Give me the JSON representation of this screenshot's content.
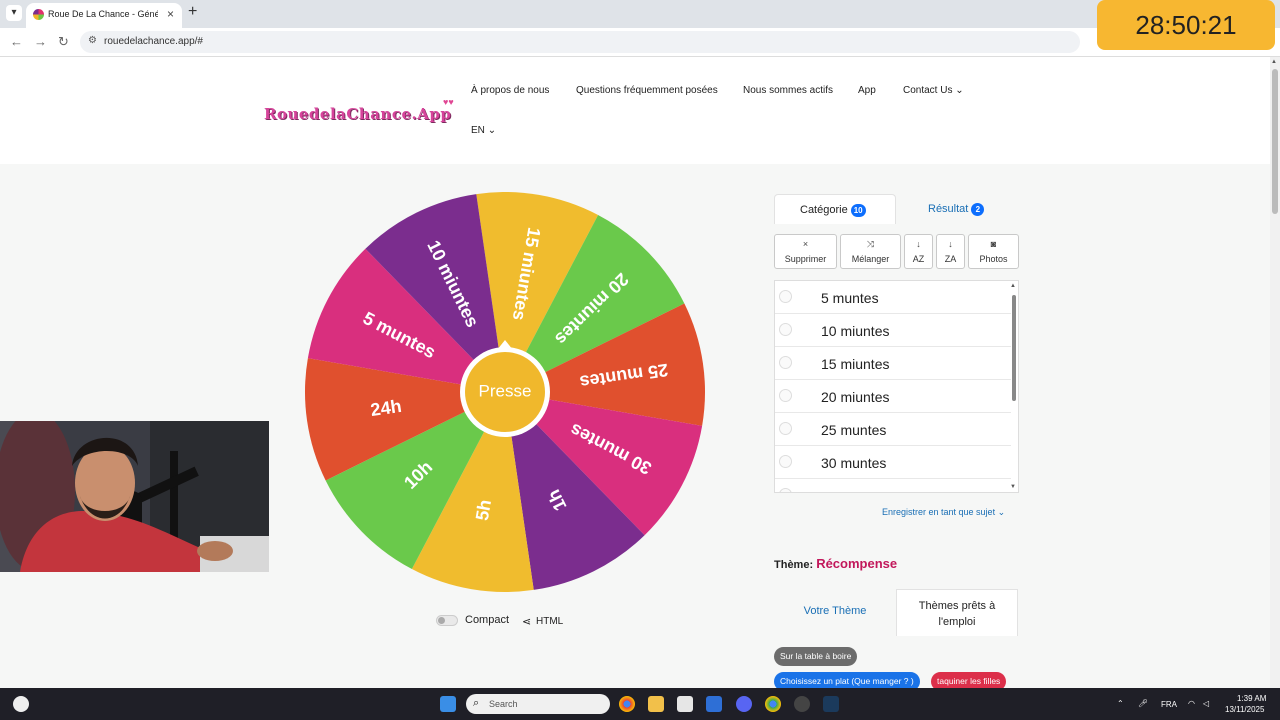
{
  "browser": {
    "tab_title": "Roue De La Chance - Générate",
    "tab_close": "×",
    "new_tab": "+",
    "url": "rouedelachance.app/#",
    "back": "←",
    "forward": "→",
    "reload": "↻"
  },
  "timer": "28:50:21",
  "site": {
    "logo": "RouedelaChance.App",
    "nav": [
      "À propos de nous",
      "Questions fréquemment posées",
      "Nous sommes actifs",
      "App",
      "Contact Us"
    ],
    "lang": "EN"
  },
  "wheel": {
    "center_label": "Presse",
    "segments": [
      {
        "label": "15 miuntes",
        "color": "#f0bc2e"
      },
      {
        "label": "20 miuntes",
        "color": "#6ac94b"
      },
      {
        "label": "25 muntes",
        "color": "#e0502e"
      },
      {
        "label": "30 muntes",
        "color": "#d92f7e"
      },
      {
        "label": "1h",
        "color": "#7b2d8e"
      },
      {
        "label": "5h",
        "color": "#f0bc2e"
      },
      {
        "label": "10h",
        "color": "#6ac94b"
      },
      {
        "label": "24h",
        "color": "#e0502e"
      },
      {
        "label": "5 muntes",
        "color": "#d92f7e"
      },
      {
        "label": "10 miuntes",
        "color": "#7b2d8e"
      }
    ],
    "compact_label": "Compact",
    "html_label": "HTML"
  },
  "panel": {
    "tab_category": "Catégorie",
    "tab_category_count": "10",
    "tab_result": "Résultat",
    "tab_result_count": "2",
    "toolbar": [
      {
        "icon": "×",
        "label": "Supprimer"
      },
      {
        "icon": "⤨",
        "label": "Mélanger"
      },
      {
        "icon": "↓",
        "label": "AZ"
      },
      {
        "icon": "↓",
        "label": "ZA"
      },
      {
        "icon": "◙",
        "label": "Photos"
      }
    ],
    "items": [
      "5 muntes",
      "10 miuntes",
      "15 miuntes",
      "20 miuntes",
      "25 muntes",
      "30 muntes"
    ],
    "save_link": "Enregistrer en tant que sujet",
    "theme_label": "Thème:",
    "theme_value": "Récompense",
    "theme_tab_own": "Votre Thème",
    "theme_tab_ready": "Thèmes prêts à l'emploi",
    "chips": [
      {
        "label": "Sur la table à boire",
        "color": "#6c6c6c"
      },
      {
        "label": "Choisissez un plat (Que manger ? )",
        "color": "#1a73e8"
      },
      {
        "label": "taquiner les filles",
        "color": "#dc2f4a"
      }
    ]
  },
  "taskbar": {
    "search_placeholder": "Search",
    "lang": "FRA",
    "time": "1:39 AM",
    "date": "13/11/2025"
  }
}
